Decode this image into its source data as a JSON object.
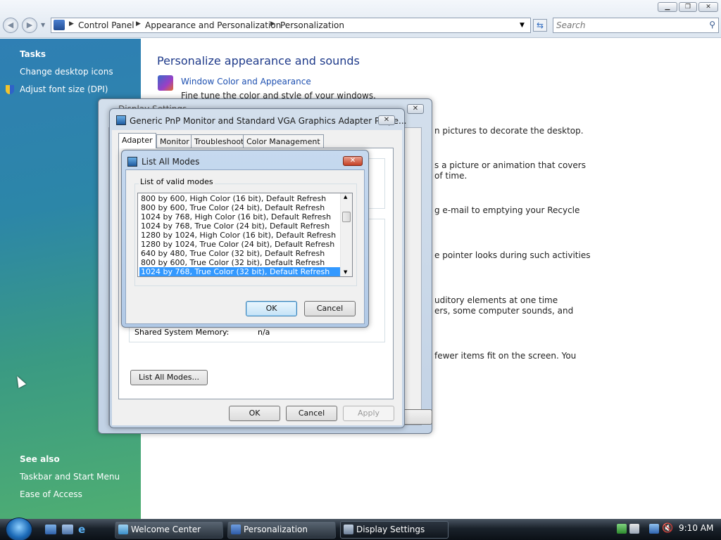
{
  "explorer": {
    "breadcrumb": [
      "Control Panel",
      "Appearance and Personalization",
      "Personalization"
    ],
    "search_placeholder": "Search",
    "window_buttons": [
      "minimize",
      "maximize",
      "close"
    ]
  },
  "sidebar": {
    "tasks_heading": "Tasks",
    "tasks": [
      {
        "label": "Change desktop icons",
        "icon": ""
      },
      {
        "label": "Adjust font size (DPI)",
        "icon": "uac-shield-icon"
      }
    ],
    "see_also_heading": "See also",
    "see_also": [
      "Taskbar and Start Menu",
      "Ease of Access"
    ]
  },
  "main": {
    "title": "Personalize appearance and sounds",
    "first_link": "Window Color and Appearance",
    "first_desc": "Fine tune the color and style of your windows.",
    "clipped_lines": [
      "n pictures to decorate the desktop.",
      "s a picture or animation that covers",
      "of time.",
      "g e-mail to emptying your Recycle",
      "e pointer looks during such activities",
      "uditory elements at one time",
      "ers, some computer sounds, and",
      "fewer items fit on the screen. You"
    ]
  },
  "display_settings": {
    "title": "Display Settings"
  },
  "properties": {
    "title": "Generic PnP Monitor and Standard VGA Graphics Adapter Prope...",
    "tabs": [
      "Adapter",
      "Monitor",
      "Troubleshoot",
      "Color Management"
    ],
    "shared_memory_label": "Shared System Memory:",
    "shared_memory_value": "n/a",
    "list_all_modes_button": "List All Modes...",
    "ok": "OK",
    "cancel": "Cancel",
    "apply": "Apply"
  },
  "list_all_modes": {
    "title": "List All Modes",
    "group_label": "List of valid modes",
    "modes": [
      "800 by 600, High Color (16 bit), Default Refresh",
      "800 by 600, True Color (24 bit), Default Refresh",
      "1024 by 768, High Color (16 bit), Default Refresh",
      "1024 by 768, True Color (24 bit), Default Refresh",
      "1280 by 1024, High Color (16 bit), Default Refresh",
      "1280 by 1024, True Color (24 bit), Default Refresh",
      "640 by 480, True Color (32 bit), Default Refresh",
      "800 by 600, True Color (32 bit), Default Refresh",
      "1024 by 768, True Color (32 bit), Default Refresh"
    ],
    "selected_index": 8,
    "ok": "OK",
    "cancel": "Cancel"
  },
  "taskbar": {
    "items": [
      "Welcome Center",
      "Personalization",
      "Display Settings"
    ],
    "active_item": "Display Settings",
    "clock": "9:10 AM"
  },
  "colors": {
    "selection": "#3399ff",
    "link": "#1c4fb0",
    "heading": "#1e3a8a"
  }
}
